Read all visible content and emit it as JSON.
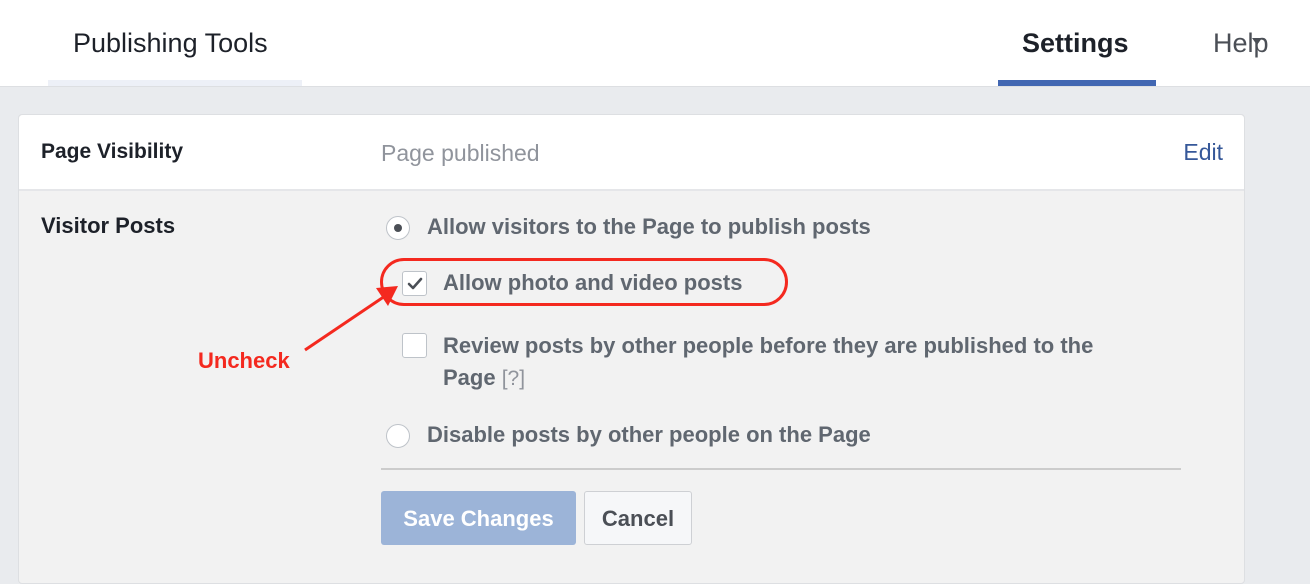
{
  "nav": {
    "tabs": [
      {
        "label": "Publishing Tools",
        "active": false
      },
      {
        "label": "Settings",
        "active": true
      },
      {
        "label": "Help",
        "has_dropdown": true
      }
    ],
    "accent_color": "#4267b2"
  },
  "page_visibility": {
    "label": "Page Visibility",
    "value": "Page published",
    "edit_label": "Edit"
  },
  "visitor_posts": {
    "label": "Visitor Posts",
    "options": [
      {
        "label": "Allow visitors to the Page to publish posts",
        "type": "radio",
        "checked": true
      },
      {
        "label": "Allow photo and video posts",
        "type": "checkbox",
        "checked": true
      },
      {
        "label_line1": "Review posts by other people before they are published to the",
        "label_line2": "Page",
        "help": "[?]",
        "type": "checkbox",
        "checked": false
      },
      {
        "label": "Disable posts by other people on the Page",
        "type": "radio",
        "checked": false
      }
    ],
    "save_label": "Save Changes",
    "cancel_label": "Cancel"
  },
  "annotation": {
    "text": "Uncheck",
    "color": "#f4291f"
  }
}
